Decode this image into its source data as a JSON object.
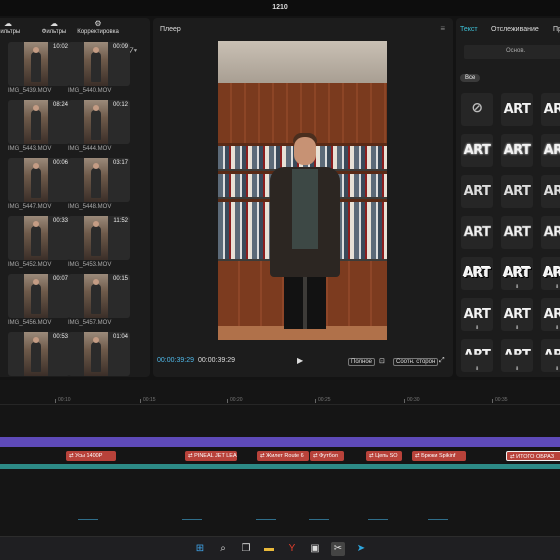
{
  "window": {
    "title": "1210"
  },
  "media": {
    "tabs": [
      {
        "label": "Фильтры",
        "icon": "filters-icon"
      },
      {
        "label": "Корректировка",
        "icon": "adjust-icon"
      }
    ],
    "clips": [
      {
        "name": "IMG_5439.MOV",
        "duration": "10:02"
      },
      {
        "name": "IMG_5440.MOV",
        "duration": "00:09"
      },
      {
        "name": "IMG_5443.MOV",
        "duration": "08:24"
      },
      {
        "name": "IMG_5444.MOV",
        "duration": "00:12"
      },
      {
        "name": "IMG_5447.MOV",
        "duration": "00:06"
      },
      {
        "name": "IMG_5448.MOV",
        "duration": "03:17"
      },
      {
        "name": "IMG_5452.MOV",
        "duration": "00:33"
      },
      {
        "name": "IMG_5453.MOV",
        "duration": "11:52"
      },
      {
        "name": "IMG_5456.MOV",
        "duration": "00:07"
      },
      {
        "name": "IMG_5457.MOV",
        "duration": "00:15"
      },
      {
        "name": "",
        "duration": "00:53"
      },
      {
        "name": "",
        "duration": "01:04"
      }
    ]
  },
  "player": {
    "title": "Плеер",
    "current_time": "00:00:39:29",
    "total_time": "00:00:39:29",
    "full_button": "Полное",
    "ratio_button": "Соотн. сторон"
  },
  "text_panel": {
    "tabs": [
      "Текст",
      "Отслеживание",
      "Пр"
    ],
    "subtab": "Основ.",
    "filter_chip": "Все",
    "preset_label": "ART"
  },
  "timeline": {
    "ticks": [
      "00:10",
      "00:15",
      "00:20",
      "00:25",
      "00:30",
      "00:35"
    ],
    "captions": [
      "Усы 1400Р",
      "PINEAL JET LEA",
      "Жилет Route 6",
      "Футбол",
      "Цепь SO",
      "Брюки Spikinf",
      "ИТОГО ОБРАЗ"
    ]
  },
  "taskbar": {
    "icons": [
      "windows-start-icon",
      "search-icon",
      "task-view-icon",
      "file-explorer-icon",
      "yandex-browser-icon",
      "app-icon",
      "capcut-icon",
      "telegram-icon"
    ]
  },
  "colors": {
    "accent": "#3ec2d8",
    "caption": "#b8423a",
    "track": "#5e4ab8",
    "teal": "#2d8a86"
  }
}
